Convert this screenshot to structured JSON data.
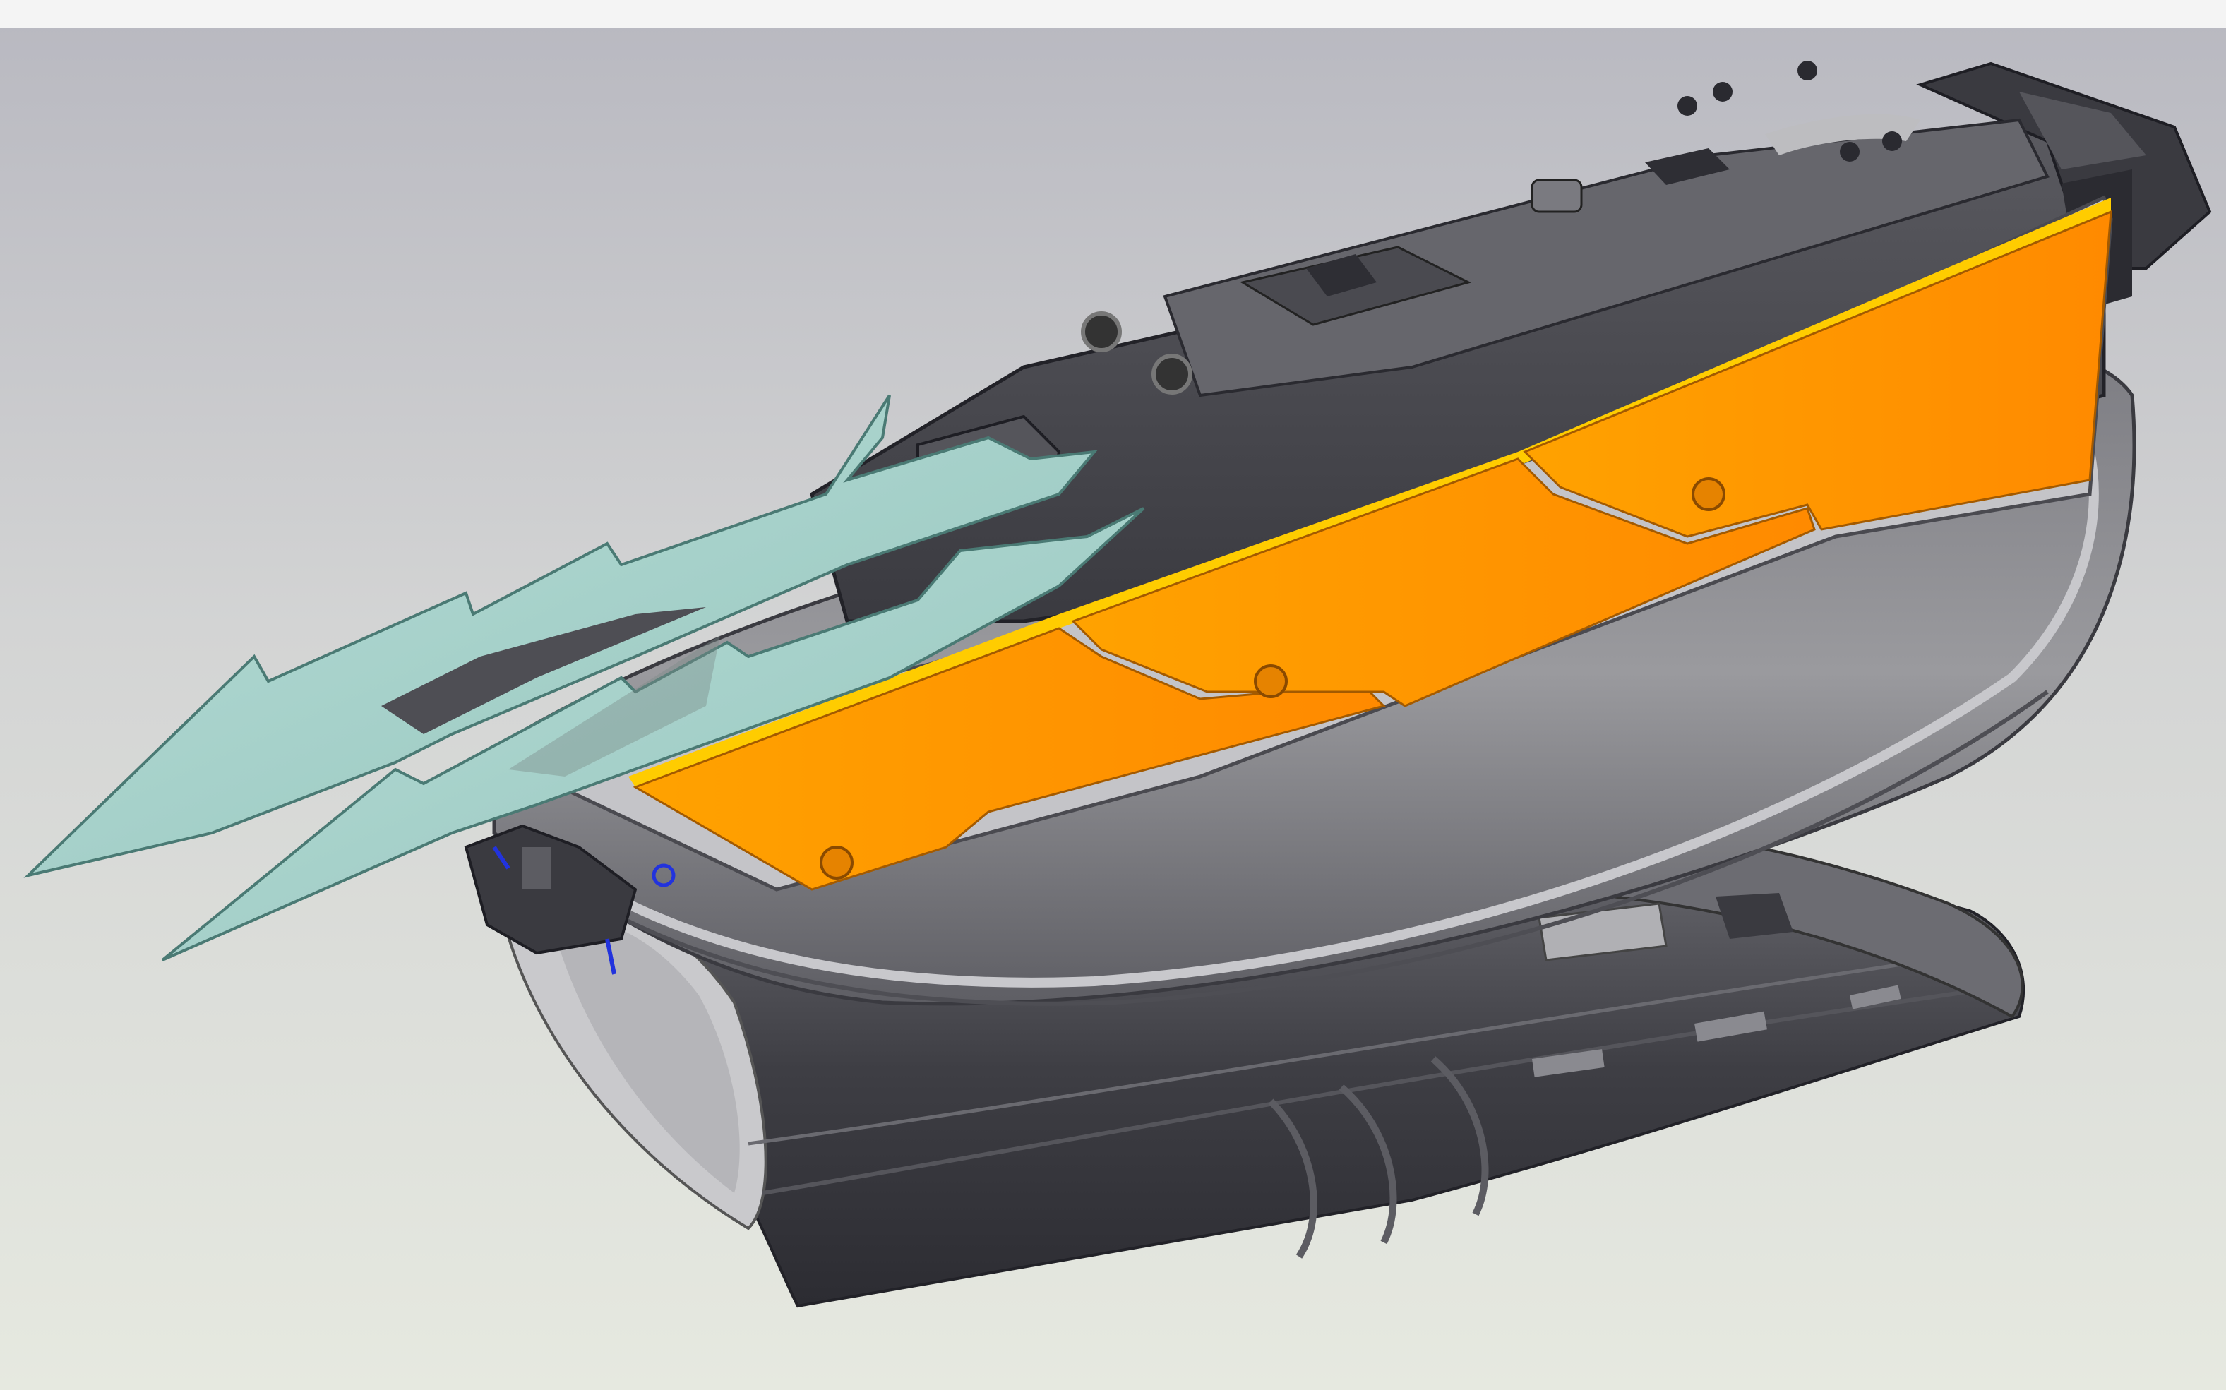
{
  "app": {
    "type": "3d-cad-viewport",
    "text_labels": []
  },
  "viewport": {
    "background_top": "#bdbdc3",
    "background_bottom": "#e6e9e0",
    "model": {
      "name": "wrist-gauntlet-with-claw-blades",
      "parts": [
        {
          "part": "claw-blades",
          "color": "#a9d3cc"
        },
        {
          "part": "orange-side-plates",
          "color": "#ff9900"
        },
        {
          "part": "top-housing",
          "color": "#4a4a50"
        },
        {
          "part": "curved-shell",
          "color": "#8b8b90"
        },
        {
          "part": "wrist-cuff",
          "color": "#3c3c42"
        },
        {
          "part": "mounting-features",
          "color": "#2f2f35"
        }
      ],
      "orange_plate_segments": 3,
      "claw_blade_count": 2
    },
    "colors": {
      "orange": "#ff9900",
      "orange_highlight": "#ffcc00",
      "blade": "#a9d3cc",
      "dark_metal": "#3e3e44",
      "mid_metal": "#6e6e74",
      "light_metal": "#b5b5b9",
      "axis_marker": "#2233dd"
    }
  }
}
